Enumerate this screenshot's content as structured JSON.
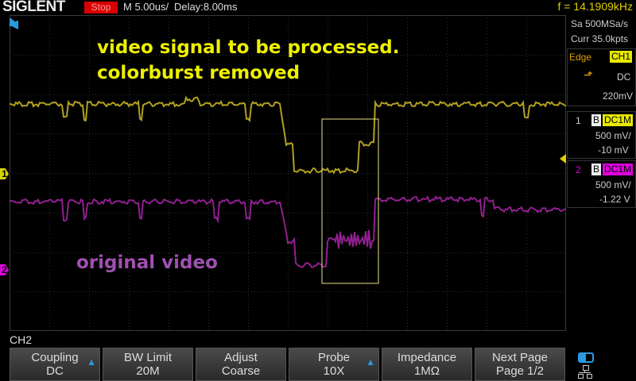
{
  "topbar": {
    "brand": "SIGLENT",
    "run_state": "Stop",
    "timebase": "M 5.00us/",
    "delay": "Delay:8.00ms",
    "frequency": "f = 14.1909kHz"
  },
  "annotations": {
    "line1": "video signal to be processed.",
    "line2": "colorburst removed",
    "line3": "original video"
  },
  "markers": {
    "ch1": "1",
    "ch2": "2"
  },
  "acquisition": {
    "sample_rate": "Sa 500MSa/s",
    "memory": "Curr 35.0kpts"
  },
  "trigger": {
    "mode": "Edge",
    "source": "CH1",
    "coupling": "DC",
    "level": "220mV"
  },
  "channels": [
    {
      "num": "1",
      "bw": "B",
      "coupling": "DC1M",
      "scale": "500 mV/",
      "offset": "-10 mV",
      "color": "#e8e800"
    },
    {
      "num": "2",
      "bw": "B",
      "coupling": "DC1M",
      "scale": "500 mV/",
      "offset": "-1.22 V",
      "color": "#e000e0"
    }
  ],
  "menu": {
    "title": "CH2",
    "buttons": [
      {
        "l1": "Coupling",
        "l2": "DC"
      },
      {
        "l1": "BW Limit",
        "l2": "20M"
      },
      {
        "l1": "Adjust",
        "l2": "Coarse"
      },
      {
        "l1": "Probe",
        "l2": "10X"
      },
      {
        "l1": "Impedance",
        "l2": "1MΩ"
      },
      {
        "l1": "Next Page",
        "l2": "Page 1/2"
      }
    ]
  },
  "colors": {
    "ch1": "#b0a020",
    "ch2": "#90208f",
    "accent": "#2a9ae0"
  }
}
